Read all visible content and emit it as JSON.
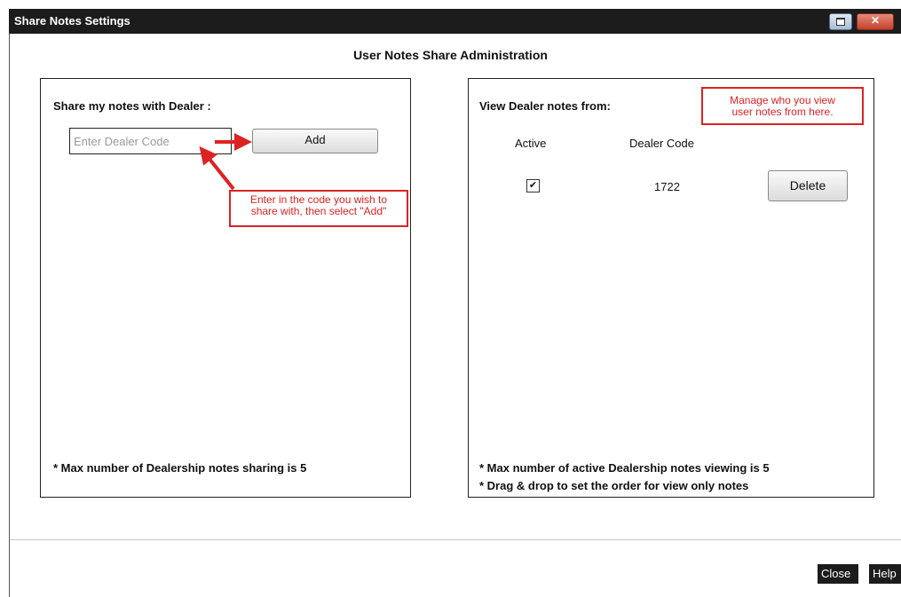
{
  "window": {
    "title": "Share Notes Settings"
  },
  "heading": "User Notes Share Administration",
  "share_panel": {
    "label": "Share my notes with Dealer :",
    "input_placeholder": "Enter Dealer Code",
    "input_value": "",
    "add_label": "Add",
    "footnote": "* Max number of Dealership notes sharing is 5",
    "annotation_line1": "Enter in the code you wish to",
    "annotation_line2": "share with, then select \"Add\""
  },
  "view_panel": {
    "label": "View Dealer notes from:",
    "annotation_line1": "Manage who you view",
    "annotation_line2": "user notes from here.",
    "columns": {
      "active": "Active",
      "dealer_code": "Dealer Code"
    },
    "rows": [
      {
        "active": true,
        "dealer_code": "1722",
        "delete_label": "Delete"
      }
    ],
    "footnote1": "* Max number of active Dealership notes viewing is  5",
    "footnote2": "* Drag & drop to set the order for view only notes"
  },
  "footer": {
    "close_label": "Close",
    "help_label": "Help"
  },
  "icons": {
    "maximize": "maximize-icon",
    "close": "close-icon",
    "arrow": "arrow-icon",
    "check": "check-icon"
  },
  "colors": {
    "annotation": "#d22222",
    "titlebar": "#1c1c1c"
  }
}
